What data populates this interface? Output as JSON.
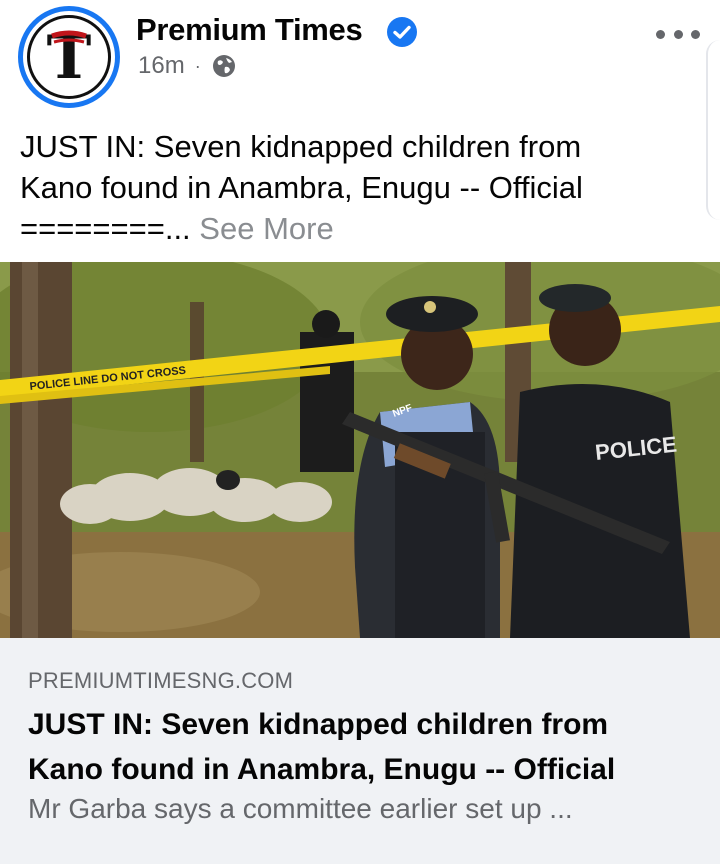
{
  "post": {
    "page_name": "Premium Times",
    "time": "16m",
    "separator": "·",
    "text_line1": "JUST IN: Seven kidnapped children from",
    "text_line2": "Kano found in Anambra, Enugu -- Official",
    "text_line3": "========...",
    "see_more": "See More"
  },
  "photo": {
    "tape_text": "POLICE LINE DO NOT CROSS",
    "vest_text": "POLICE",
    "badge_text": "NPF"
  },
  "link_card": {
    "domain": "PREMIUMTIMESNG.COM",
    "title_line1": "JUST IN: Seven kidnapped children from",
    "title_line2": "Kano found in Anambra, Enugu -- Official",
    "description": "Mr Garba says a committee earlier set up ..."
  },
  "colors": {
    "accent": "#1877f2",
    "secondary_text": "#65676b",
    "card_background": "#f0f2f5"
  },
  "icons": [
    "verified-badge-icon",
    "globe-icon",
    "more-options-icon"
  ]
}
